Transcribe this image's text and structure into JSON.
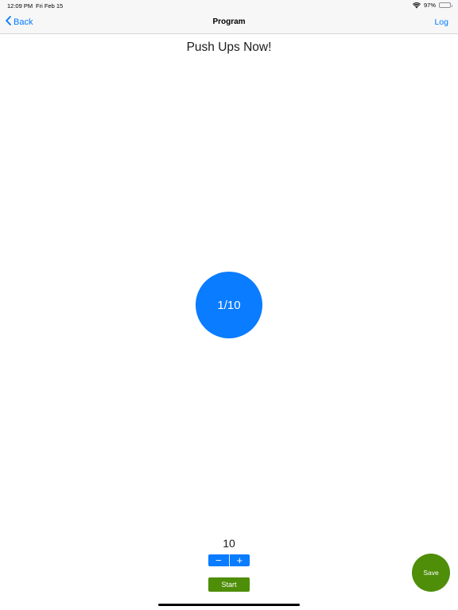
{
  "status_bar": {
    "time": "12:09 PM",
    "date": "Fri Feb 15",
    "battery_percent": "97%",
    "battery_level": 0.97,
    "icons": [
      "wifi-icon",
      "battery-icon"
    ]
  },
  "nav": {
    "back_label": "Back",
    "title": "Program",
    "log_label": "Log",
    "back_icon": "chevron-left-icon"
  },
  "main": {
    "heading": "Push Ups Now!",
    "counter": "1/10",
    "target_value": "10",
    "decrement_label": "−",
    "increment_label": "+",
    "start_label": "Start",
    "save_label": "Save"
  },
  "colors": {
    "accent_blue": "#007aff",
    "circle_blue": "#0a7cff",
    "action_green": "#4e8e08"
  }
}
